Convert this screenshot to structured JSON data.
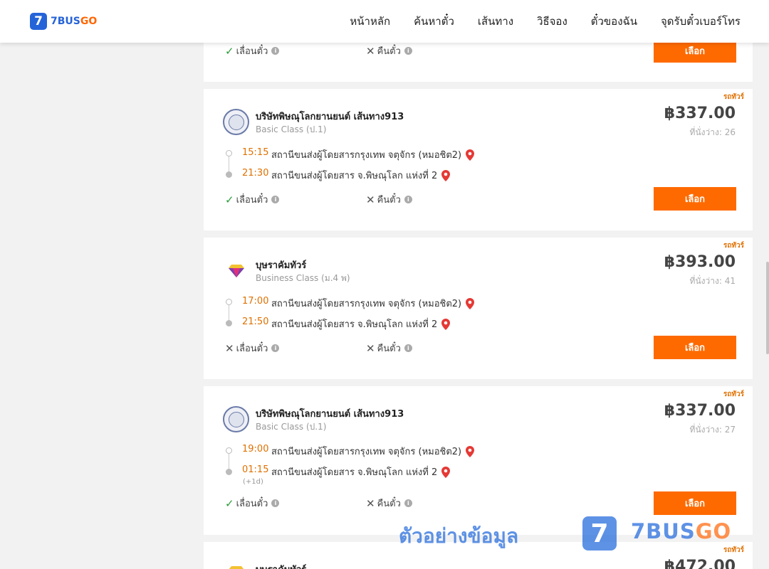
{
  "header": {
    "logo_badge": "7",
    "logo_text_main": "7BUS",
    "logo_text_accent": "GO",
    "nav": [
      "หน้าหลัก",
      "ค้นหาตั๋ว",
      "เส้นทาง",
      "วิธีจอง",
      "ตั๋วของฉัน",
      "จุดรับตั๋วเบอร์โทร"
    ]
  },
  "labels": {
    "reschedule": "เลื่อนตั๋ว",
    "refund": "คืนตั๋ว",
    "select": "เลือก",
    "seats_prefix": "ที่นั่งว่าง: ",
    "info": "i",
    "check": "✓",
    "cross": "✕",
    "plus1d": "(+1d)"
  },
  "first_card": {
    "reschedule": true,
    "refund": false
  },
  "trips": [
    {
      "tag": "รถทัวร์",
      "company": "บริษัทพิษณุโลกยานยนต์ เส้นทาง913",
      "class": "Basic Class (ป.1)",
      "price": "฿337.00",
      "seats": "26",
      "depart_time": "15:15",
      "depart_station": "สถานีขนส่งผู้โดยสารกรุงเทพ จตุจักร (หมอชิต2)",
      "arrive_time": "21:30",
      "arrive_station": "สถานีขนส่งผู้โดยสาร จ.พิษณุโลก แห่งที่ 2",
      "reschedule": true,
      "refund": false,
      "next_day": false
    },
    {
      "tag": "รถทัวร์",
      "company": "บุษราคัมทัวร์",
      "class": "Business Class (ม.4 พ)",
      "price": "฿393.00",
      "seats": "41",
      "depart_time": "17:00",
      "depart_station": "สถานีขนส่งผู้โดยสารกรุงเทพ จตุจักร (หมอชิต2)",
      "arrive_time": "21:50",
      "arrive_station": "สถานีขนส่งผู้โดยสาร จ.พิษณุโลก แห่งที่ 2",
      "reschedule": false,
      "refund": false,
      "next_day": false
    },
    {
      "tag": "รถทัวร์",
      "company": "บริษัทพิษณุโลกยานยนต์ เส้นทาง913",
      "class": "Basic Class (ป.1)",
      "price": "฿337.00",
      "seats": "27",
      "depart_time": "19:00",
      "depart_station": "สถานีขนส่งผู้โดยสารกรุงเทพ จตุจักร (หมอชิต2)",
      "arrive_time": "01:15",
      "arrive_station": "สถานีขนส่งผู้โดยสาร จ.พิษณุโลก แห่งที่ 2",
      "reschedule": true,
      "refund": false,
      "next_day": true
    }
  ],
  "partial_trip": {
    "tag": "รถทัวร์",
    "company": "บุษราคัมทัวร์",
    "price": "฿472.00"
  },
  "watermark": {
    "text": "ตัวอย่างข้อมูล",
    "badge": "7",
    "brand_main": "7BUS",
    "brand_accent": "GO"
  },
  "colors": {
    "accent": "#ff6a00",
    "brand_blue": "#2563d8",
    "time": "#e07000",
    "check": "#2a9d3a",
    "pin": "#e53935"
  }
}
